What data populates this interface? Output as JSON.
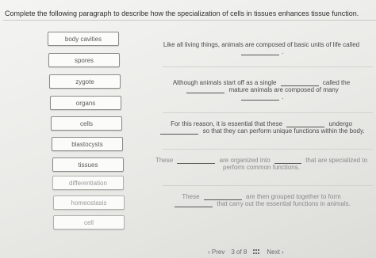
{
  "instruction": "Complete the following paragraph to describe how the specialization of cells in tissues enhances tissue function.",
  "word_bank": [
    "body cavities",
    "spores",
    "zygote",
    "organs",
    "cells",
    "blastocysts",
    "tissues",
    "differentiation",
    "homeostasis",
    "cell"
  ],
  "paragraphs": [
    {
      "parts": [
        "Like all living things, animals are composed of basic units of life called",
        "."
      ]
    },
    {
      "parts": [
        "Although animals start off as a single",
        "called the",
        "mature animals are composed of many",
        "."
      ]
    },
    {
      "parts": [
        "For this reason, it is essential that these",
        "undergo",
        "so that they can perform unique functions within the body."
      ]
    },
    {
      "parts": [
        "These",
        "are organized into",
        "that are specialized to perform common functions."
      ]
    },
    {
      "parts": [
        "These",
        "are then grouped together to form",
        "that carry out the essential functions in animals."
      ]
    }
  ],
  "footer": {
    "prev_label": "Prev",
    "page_indicator": "3 of 8",
    "next_label": "Next"
  }
}
